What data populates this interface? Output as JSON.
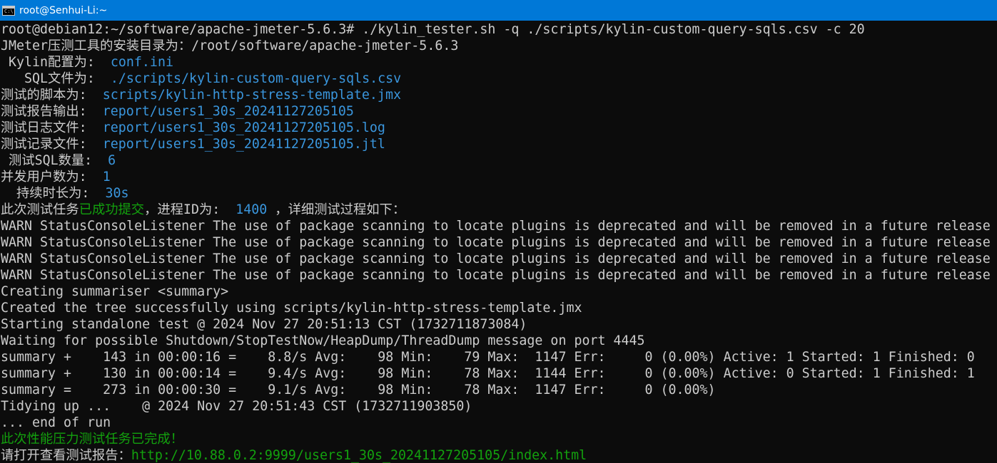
{
  "window": {
    "title": "root@Senhui-Li:~",
    "icon": "console-icon",
    "icon_glyph": "C:\\",
    "titlebar_color": "#0078d7"
  },
  "colors": {
    "background": "#0c0c0c",
    "default_text": "#cccccc",
    "blue": "#3a96dd",
    "green": "#13a10e"
  },
  "console": {
    "lines": [
      {
        "segments": [
          {
            "text": "root@debian12:~/software/apache-jmeter-5.6.3# ./kylin_tester.sh -q ./scripts/kylin-custom-query-sqls.csv -c 20",
            "color": "default"
          }
        ]
      },
      {
        "segments": [
          {
            "text": "JMeter压测工具的安装目录为：/root/software/apache-jmeter-5.6.3",
            "color": "default"
          }
        ]
      },
      {
        "segments": [
          {
            "text": " Kylin配置为:  ",
            "color": "default"
          },
          {
            "text": "conf.ini",
            "color": "blue"
          }
        ]
      },
      {
        "segments": [
          {
            "text": "   SQL文件为:  ",
            "color": "default"
          },
          {
            "text": "./scripts/kylin-custom-query-sqls.csv",
            "color": "blue"
          }
        ]
      },
      {
        "segments": [
          {
            "text": "测试的脚本为:  ",
            "color": "default"
          },
          {
            "text": "scripts/kylin-http-stress-template.jmx",
            "color": "blue"
          }
        ]
      },
      {
        "segments": [
          {
            "text": "测试报告输出:  ",
            "color": "default"
          },
          {
            "text": "report/users1_30s_20241127205105",
            "color": "blue"
          }
        ]
      },
      {
        "segments": [
          {
            "text": "测试日志文件:  ",
            "color": "default"
          },
          {
            "text": "report/users1_30s_20241127205105.log",
            "color": "blue"
          }
        ]
      },
      {
        "segments": [
          {
            "text": "测试记录文件:  ",
            "color": "default"
          },
          {
            "text": "report/users1_30s_20241127205105.jtl",
            "color": "blue"
          }
        ]
      },
      {
        "segments": [
          {
            "text": " 测试SQL数量:  ",
            "color": "default"
          },
          {
            "text": "6",
            "color": "blue"
          }
        ]
      },
      {
        "segments": [
          {
            "text": "并发用户数为:  ",
            "color": "default"
          },
          {
            "text": "1",
            "color": "blue"
          }
        ]
      },
      {
        "segments": [
          {
            "text": "  持续时长为:  ",
            "color": "default"
          },
          {
            "text": "30s",
            "color": "blue"
          }
        ]
      },
      {
        "segments": [
          {
            "text": "此次测试任务",
            "color": "default"
          },
          {
            "text": "已成功提交",
            "color": "green"
          },
          {
            "text": "，进程ID为:  ",
            "color": "default"
          },
          {
            "text": "1400",
            "color": "blue"
          },
          {
            "text": " ，详细测试过程如下：",
            "color": "default"
          }
        ]
      },
      {
        "segments": [
          {
            "text": "WARN StatusConsoleListener The use of package scanning to locate plugins is deprecated and will be removed in a future release",
            "color": "default"
          }
        ]
      },
      {
        "segments": [
          {
            "text": "WARN StatusConsoleListener The use of package scanning to locate plugins is deprecated and will be removed in a future release",
            "color": "default"
          }
        ]
      },
      {
        "segments": [
          {
            "text": "WARN StatusConsoleListener The use of package scanning to locate plugins is deprecated and will be removed in a future release",
            "color": "default"
          }
        ]
      },
      {
        "segments": [
          {
            "text": "WARN StatusConsoleListener The use of package scanning to locate plugins is deprecated and will be removed in a future release",
            "color": "default"
          }
        ]
      },
      {
        "segments": [
          {
            "text": "Creating summariser <summary>",
            "color": "default"
          }
        ]
      },
      {
        "segments": [
          {
            "text": "Created the tree successfully using scripts/kylin-http-stress-template.jmx",
            "color": "default"
          }
        ]
      },
      {
        "segments": [
          {
            "text": "Starting standalone test @ 2024 Nov 27 20:51:13 CST (1732711873084)",
            "color": "default"
          }
        ]
      },
      {
        "segments": [
          {
            "text": "Waiting for possible Shutdown/StopTestNow/HeapDump/ThreadDump message on port 4445",
            "color": "default"
          }
        ]
      },
      {
        "segments": [
          {
            "text": "summary +    143 in 00:00:16 =    8.8/s Avg:    98 Min:    79 Max:  1147 Err:     0 (0.00%) Active: 1 Started: 1 Finished: 0",
            "color": "default"
          }
        ]
      },
      {
        "segments": [
          {
            "text": "summary +    130 in 00:00:14 =    9.4/s Avg:    98 Min:    78 Max:  1144 Err:     0 (0.00%) Active: 0 Started: 1 Finished: 1",
            "color": "default"
          }
        ]
      },
      {
        "segments": [
          {
            "text": "summary =    273 in 00:00:30 =    9.1/s Avg:    98 Min:    78 Max:  1147 Err:     0 (0.00%)",
            "color": "default"
          }
        ]
      },
      {
        "segments": [
          {
            "text": "Tidying up ...    @ 2024 Nov 27 20:51:43 CST (1732711903850)",
            "color": "default"
          }
        ]
      },
      {
        "segments": [
          {
            "text": "... end of run",
            "color": "default"
          }
        ]
      },
      {
        "segments": [
          {
            "text": "此次性能压力测试任务已完成！",
            "color": "green"
          }
        ]
      },
      {
        "segments": [
          {
            "text": "请打开查看测试报告：",
            "color": "default"
          },
          {
            "text": "http://10.88.0.2:9999/users1_30s_20241127205105/index.html",
            "color": "green"
          }
        ]
      }
    ]
  }
}
